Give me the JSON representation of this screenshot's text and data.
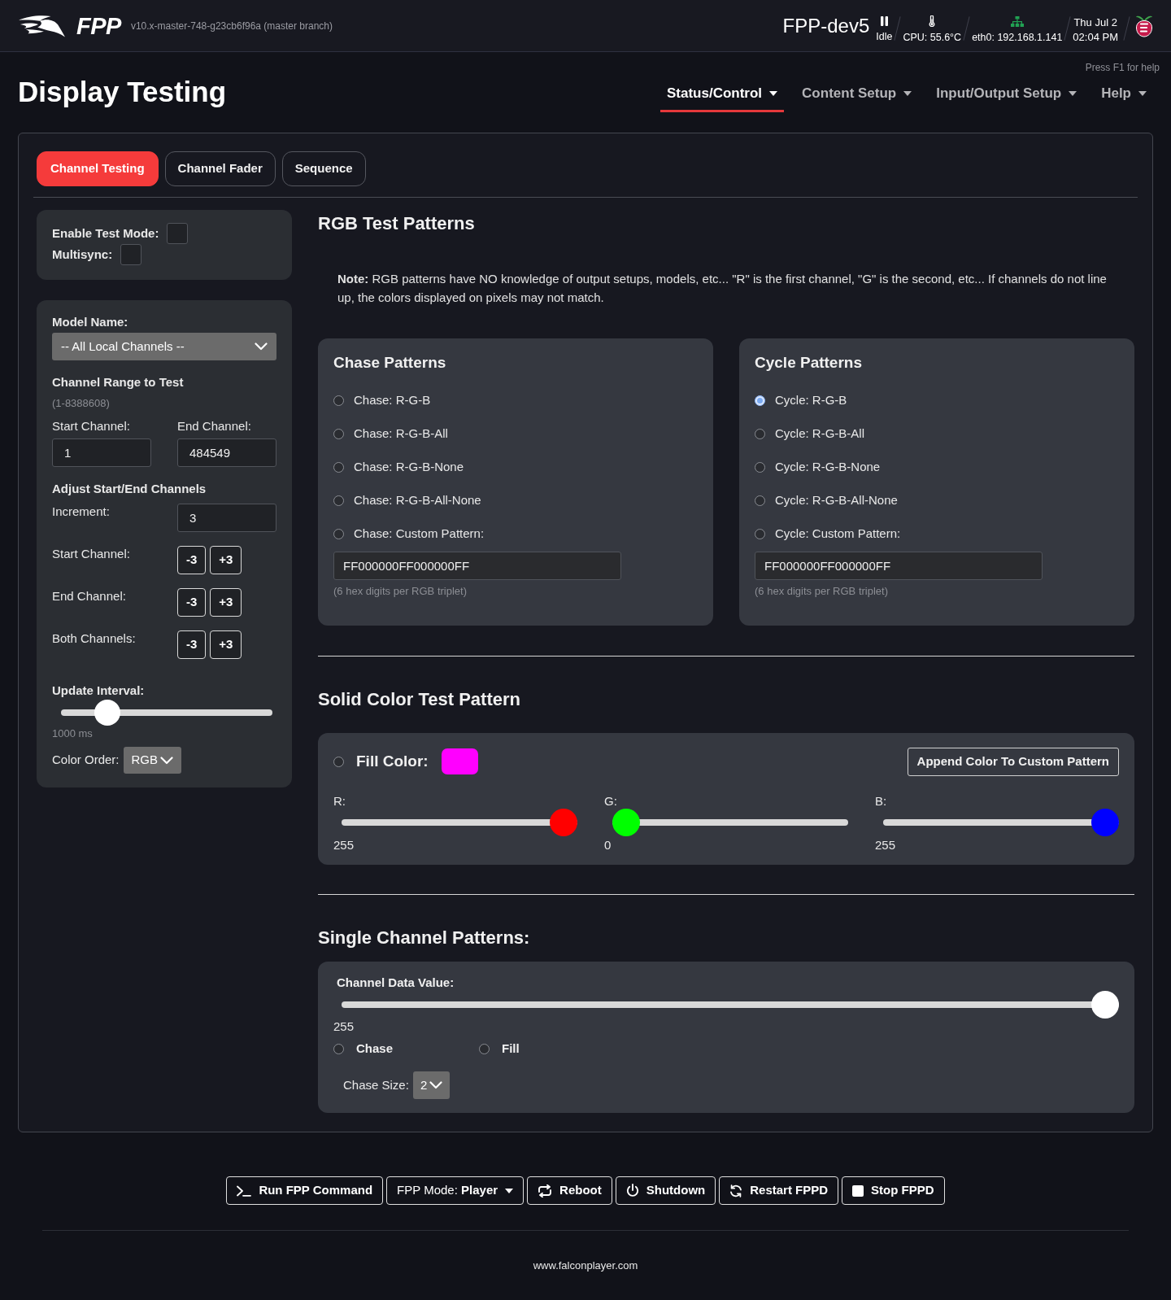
{
  "header": {
    "logo_text": "FPP",
    "version": "v10.x-master-748-g23cb6f96a (master branch)",
    "hostname": "FPP-dev5",
    "status": [
      {
        "kind": "player",
        "label": "Idle"
      },
      {
        "kind": "temperature",
        "label": "CPU: 55.6°C"
      },
      {
        "kind": "network",
        "label": "eth0: 192.168.1.141"
      },
      {
        "kind": "datetime",
        "date": "Thu Jul 2",
        "time": "02:04 PM"
      }
    ]
  },
  "help_hint": "Press F1 for help",
  "page_title": "Display Testing",
  "nav": [
    {
      "label": "Status/Control",
      "selected": true
    },
    {
      "label": "Content Setup",
      "selected": false
    },
    {
      "label": "Input/Output Setup",
      "selected": false
    },
    {
      "label": "Help",
      "selected": false
    }
  ],
  "tabs": [
    {
      "label": "Channel Testing",
      "selected": true
    },
    {
      "label": "Channel Fader",
      "selected": false
    },
    {
      "label": "Sequence",
      "selected": false
    }
  ],
  "test_mode": [
    {
      "label": "Enable Test Mode:",
      "checked": false
    },
    {
      "label": "Multisync:",
      "checked": false
    }
  ],
  "model": {
    "label": "Model Name:",
    "value": "-- All Local Channels --"
  },
  "range": {
    "title": "Channel Range to Test",
    "hint": "(1-8388608)",
    "fields": [
      {
        "label": "Start Channel:",
        "value": "1"
      },
      {
        "label": "End Channel:",
        "value": "484549"
      }
    ]
  },
  "adjust": {
    "title": "Adjust Start/End Channels",
    "increment": {
      "label": "Increment:",
      "value": "3"
    },
    "rows": [
      {
        "label": "Start Channel:",
        "buttons": [
          "-3",
          "+3"
        ]
      },
      {
        "label": "End Channel:",
        "buttons": [
          "-3",
          "+3"
        ]
      },
      {
        "label": "Both Channels:",
        "buttons": [
          "-3",
          "+3"
        ]
      }
    ]
  },
  "update_interval": {
    "label": "Update Interval:",
    "level": 0.18,
    "reading": "1000 ms"
  },
  "color_order": {
    "label": "Color Order:",
    "value": "RGB"
  },
  "rgb_patterns": {
    "title": "RGB Test Patterns",
    "note": "**Note:** RGB patterns have NO knowledge of output setups, models, etc... \"R\" is the first channel, \"G\" is the second, etc... If channels do not line up, the colors displayed on pixels may not match.",
    "groups": [
      {
        "title": "Chase Patterns",
        "options": [
          {
            "label": "Chase: R-G-B",
            "selected": false
          },
          {
            "label": "Chase: R-G-B-All",
            "selected": false
          },
          {
            "label": "Chase: R-G-B-None",
            "selected": false
          },
          {
            "label": "Chase: R-G-B-All-None",
            "selected": false
          },
          {
            "label": "Chase: Custom Pattern:",
            "selected": false
          }
        ],
        "custom_value": "FF000000FF000000FF",
        "custom_hint": "(6 hex digits per RGB triplet)"
      },
      {
        "title": "Cycle Patterns",
        "options": [
          {
            "label": "Cycle: R-G-B",
            "selected": true
          },
          {
            "label": "Cycle: R-G-B-All",
            "selected": false
          },
          {
            "label": "Cycle: R-G-B-None",
            "selected": false
          },
          {
            "label": "Cycle: R-G-B-All-None",
            "selected": false
          },
          {
            "label": "Cycle: Custom Pattern:",
            "selected": false
          }
        ],
        "custom_value": "FF000000FF000000FF",
        "custom_hint": "(6 hex digits per RGB triplet)"
      }
    ]
  },
  "solid_color": {
    "title": "Solid Color Test Pattern",
    "fill": {
      "label": "Fill Color:",
      "selected": false,
      "color": "#ff00ff"
    },
    "append_button": "Append Color To Custom Pattern",
    "channels": [
      {
        "label": "R:",
        "color": "#ff0000",
        "level": 1,
        "reading": "255"
      },
      {
        "label": "G:",
        "color": "#00ff00",
        "level": 0,
        "reading": "0"
      },
      {
        "label": "B:",
        "color": "#0000ff",
        "level": 1,
        "reading": "255"
      }
    ]
  },
  "single_channel": {
    "title": "Single Channel Patterns:",
    "value_label": "Channel Data Value:",
    "level": 1,
    "reading": "255",
    "modes": [
      {
        "label": "Chase",
        "selected": false
      },
      {
        "label": "Fill",
        "selected": false
      }
    ],
    "chase_size": {
      "label": "Chase Size:",
      "value": "2"
    }
  },
  "actions": [
    {
      "kind": "command",
      "label": "Run FPP Command"
    },
    {
      "kind": "mode",
      "label": "FPP Mode: **Player**"
    },
    {
      "kind": "reboot",
      "label": "Reboot"
    },
    {
      "kind": "shutdown",
      "label": "Shutdown"
    },
    {
      "kind": "restart",
      "label": "Restart FPPD"
    },
    {
      "kind": "stop",
      "label": "Stop FPPD"
    }
  ],
  "footer": "www.falconplayer.com"
}
